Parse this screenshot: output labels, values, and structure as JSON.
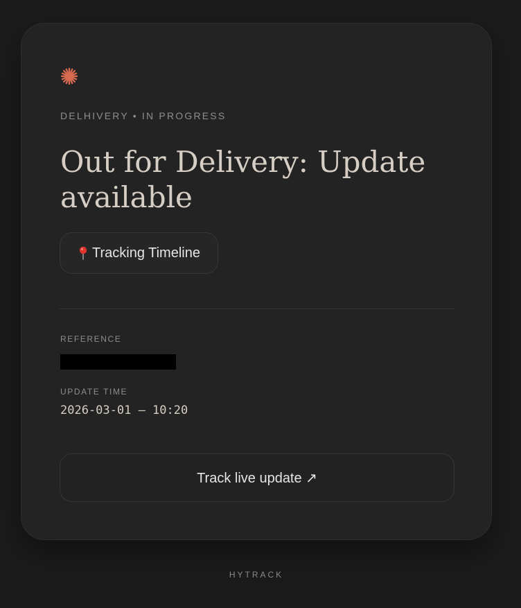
{
  "card": {
    "carrier_status": "DELHIVERY • IN PROGRESS",
    "title": "Out for Delivery: Update available",
    "timeline_button": {
      "icon": "pin-icon",
      "label": "Tracking Timeline"
    },
    "reference": {
      "label": "REFERENCE"
    },
    "update_time": {
      "label": "UPDATE TIME",
      "value": "2026-03-01 — 10:20"
    },
    "track_button": {
      "label": "Track live update ↗"
    }
  },
  "footer": {
    "brand": "HYTRACK"
  },
  "colors": {
    "background": "#1b1b1b",
    "card": "#232323",
    "accent_star": "#d86a4f",
    "title": "#d6cec4",
    "muted": "#8e8e8e"
  },
  "icons": {
    "brand_mark": "starburst-icon"
  }
}
